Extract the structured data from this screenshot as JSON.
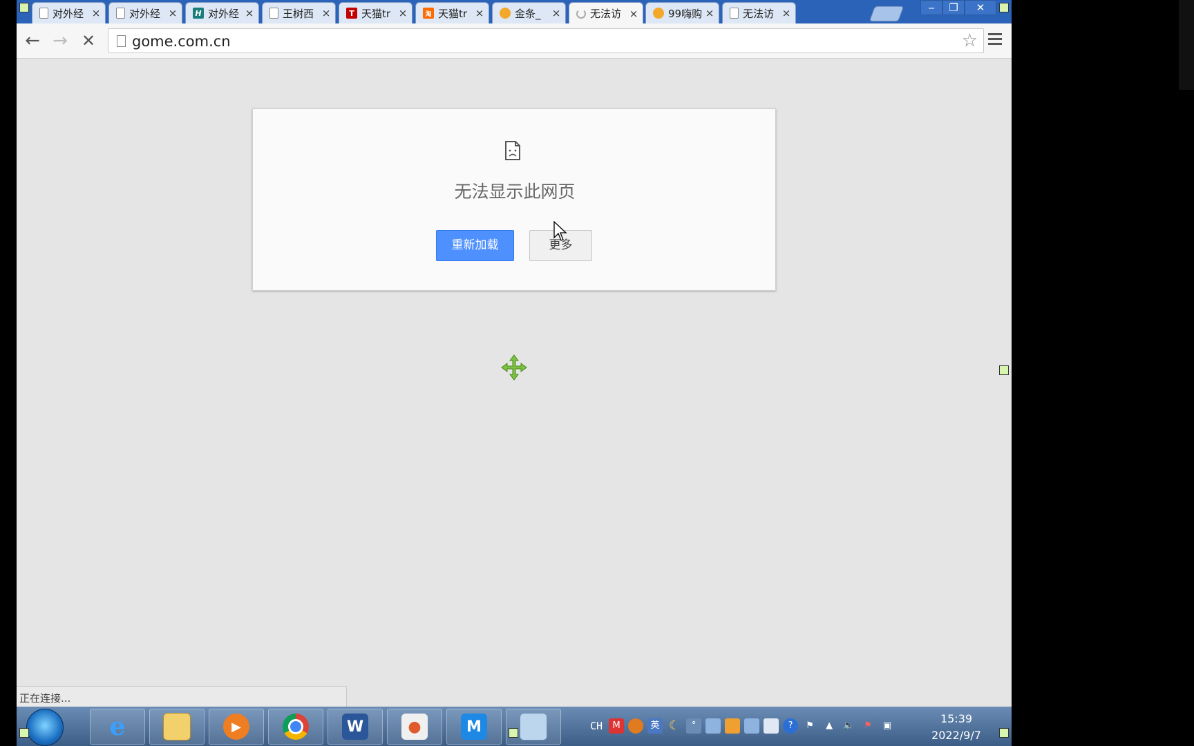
{
  "tabs": [
    {
      "title": "对外经",
      "icon": "page-icon"
    },
    {
      "title": "对外经",
      "icon": "page-icon"
    },
    {
      "title": "对外经",
      "icon": "h-logo-icon"
    },
    {
      "title": "王树西",
      "icon": "page-icon"
    },
    {
      "title": "天猫tr",
      "icon": "tmall-icon"
    },
    {
      "title": "天猫tr",
      "icon": "taobao-icon"
    },
    {
      "title": "金条_",
      "icon": "tmall-cat-icon"
    },
    {
      "title": "无法访",
      "icon": "loading-spinner-icon"
    },
    {
      "title": "99嗨购",
      "icon": "tmall-cat-icon"
    },
    {
      "title": "无法访",
      "icon": "page-icon"
    }
  ],
  "omnibox": {
    "url": "gome.com.cn"
  },
  "error": {
    "title": "无法显示此网页",
    "reload_label": "重新加载",
    "more_label": "更多"
  },
  "status": {
    "text": "正在连接..."
  },
  "taskbar": {
    "apps": [
      "ie-icon",
      "file-explorer-icon",
      "media-player-icon",
      "chrome-icon",
      "word-icon",
      "presentation-icon",
      "maxthon-icon",
      "notepad-icon"
    ],
    "language": "CH",
    "time": "15:39",
    "date": "2022/9/7"
  },
  "colors": {
    "accent_blue": "#4d90fe",
    "tabstrip": "#2b63b8"
  }
}
